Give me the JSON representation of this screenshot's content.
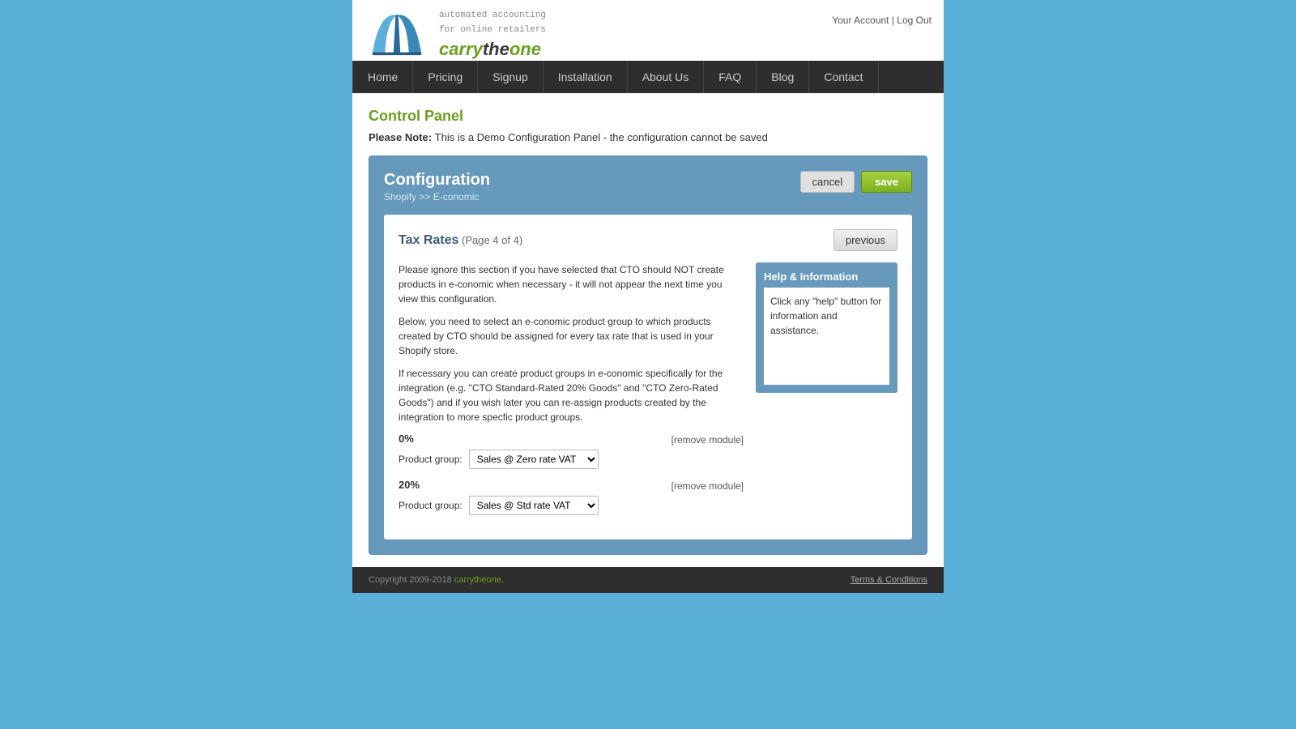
{
  "header": {
    "tagline_line1": "automated accounting",
    "tagline_line2": "for online retailers",
    "logo_carry": "carry",
    "logo_the": "the",
    "logo_one": "one",
    "account_link": "Your Account",
    "separator": "|",
    "logout_link": "Log Out"
  },
  "nav": {
    "items": [
      {
        "label": "Home",
        "id": "home"
      },
      {
        "label": "Pricing",
        "id": "pricing"
      },
      {
        "label": "Signup",
        "id": "signup"
      },
      {
        "label": "Installation",
        "id": "installation"
      },
      {
        "label": "About Us",
        "id": "about-us"
      },
      {
        "label": "FAQ",
        "id": "faq"
      },
      {
        "label": "Blog",
        "id": "blog"
      },
      {
        "label": "Contact",
        "id": "contact"
      }
    ]
  },
  "control_panel": {
    "title": "Control Panel",
    "demo_note_prefix": "Please Note: ",
    "demo_note_text": "This is a Demo Configuration Panel - the configuration cannot be saved"
  },
  "configuration": {
    "title": "Configuration",
    "subtitle": "Shopify >> E-conomic",
    "cancel_label": "cancel",
    "save_label": "save",
    "tax_rates": {
      "title": "Tax Rates",
      "page_info": "(Page 4 of 4)",
      "previous_label": "previous",
      "info_paragraph1": "Please ignore this section if you have selected that CTO should NOT create products in e-conomic when necessary - it will not appear the next time you view this configuration.",
      "info_paragraph2": "Below, you need to select an e-conomic product group to which products created by CTO should be assigned for every tax rate that is used in your Shopify store.",
      "info_paragraph3": "If necessary you can create product groups in e-conomic specifically for the integration (e.g. \"CTO Standard-Rated 20% Goods\" and \"CTO Zero-Rated Goods\") and if you wish later you can re-assign products created by the integration to more specfic product groups.",
      "rates": [
        {
          "rate": "0%",
          "remove_label": "[remove module]",
          "product_group_label": "Product group:",
          "selected_option": "Sales @ Zero rate VAT",
          "options": [
            "Sales @ Zero rate VAT",
            "Sales @ Std rate VAT"
          ]
        },
        {
          "rate": "20%",
          "remove_label": "[remove module]",
          "product_group_label": "Product group:",
          "selected_option": "Sales @ Std rate VAT",
          "options": [
            "Sales @ Zero rate VAT",
            "Sales @ Std rate VAT"
          ]
        }
      ]
    },
    "help": {
      "title": "Help & Information",
      "content": "Click any \"help\" button for information and assistance."
    }
  },
  "footer": {
    "copyright": "Copyright 2009-2018 ",
    "brand": "carrytheone",
    "copyright_end": ".",
    "terms_label": "Terms & Conditions"
  }
}
